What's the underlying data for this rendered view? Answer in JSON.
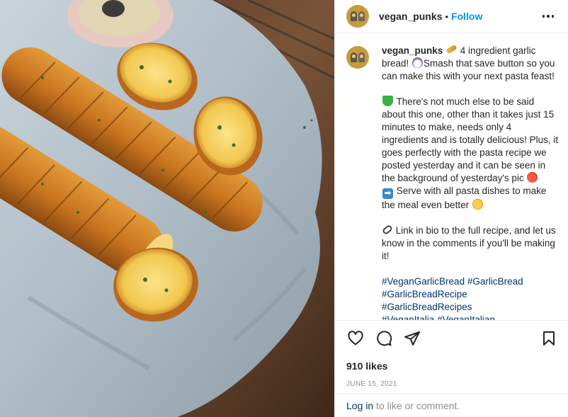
{
  "post": {
    "username": "vegan_punks",
    "separator": "•",
    "follow_label": "Follow",
    "more_icon": "more-horizontal-icon"
  },
  "caption": {
    "username": "vegan_punks",
    "line1": " 4 ingredient garlic bread! ",
    "line2": "Smash that save button so you can make this with your next pasta feast!",
    "para2": " There's not much else to be said about this one, other than it takes just 15 minutes to make, needs only 4 ingredients and is totally delicious! Plus, it goes perfectly with the pasta recipe we posted yesterday and it can be seen in the background of yesterday's pic ",
    "para3": " Serve with all pasta dishes to make the meal even better ",
    "para4": " Link in bio to the full recipe, and let us know in the comments if you'll be making it!",
    "hashtags": [
      "#VeganGarlicBread",
      "#GarlicBread",
      "#GarlicBreadRecipe",
      "#GarlicBreadRecipes",
      "#VeganItalia",
      "#VeganItalian"
    ],
    "emoji_arrow": "➡"
  },
  "actions": {
    "like_icon": "heart-icon",
    "comment_icon": "comment-icon",
    "share_icon": "share-icon",
    "save_icon": "bookmark-icon"
  },
  "likes": "910 likes",
  "date": "JUNE 15, 2021",
  "login": {
    "link": "Log in",
    "rest": " to like or comment."
  },
  "colors": {
    "accent_blue": "#0095f6",
    "hashtag_blue": "#00376b",
    "muted": "#8e8e8e",
    "text": "#262626"
  }
}
